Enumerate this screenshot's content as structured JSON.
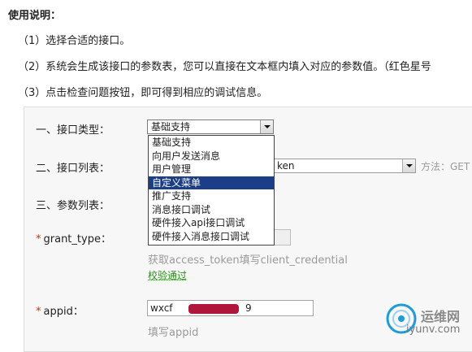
{
  "instructions": {
    "title": "使用说明：",
    "line1": "（1）选择合适的接口。",
    "line2": "（2）系统会生成该接口的参数表，您可以直接在文本框内填入对应的参数值。（红色星号",
    "line3": "（3）点击检查问题按钮，即可得到相应的调试信息。"
  },
  "form": {
    "interface_type_label": "一、接口类型：",
    "interface_type_value": "基础支持",
    "interface_type_options": [
      "基础支持",
      "向用户发送消息",
      "用户管理",
      "自定义菜单",
      "推广支持",
      "消息接口调试",
      "硬件接入api接口调试",
      "硬件接入消息接口调试"
    ],
    "interface_type_selected_index": 3,
    "interface_list_label": "二、接口列表：",
    "interface_list_value": "ken",
    "method_label": "方法：GET",
    "param_list_label": "三、参数列表：",
    "grant_type_label": "grant_type：",
    "grant_type_hint": "获取access_token填写client_credential",
    "grant_type_check": "校验通过",
    "appid_label": "appid：",
    "appid_value": "wxcf",
    "appid_value_tail": "9",
    "appid_hint": "填写appid",
    "required_mark": "*"
  },
  "watermark": {
    "cn": "运维网",
    "en": "iyunv.com"
  },
  "colors": {
    "selected_bg": "#1b3e87",
    "required": "#e1251b",
    "ok": "#2f8a1f",
    "hint": "#9a9a9a"
  }
}
